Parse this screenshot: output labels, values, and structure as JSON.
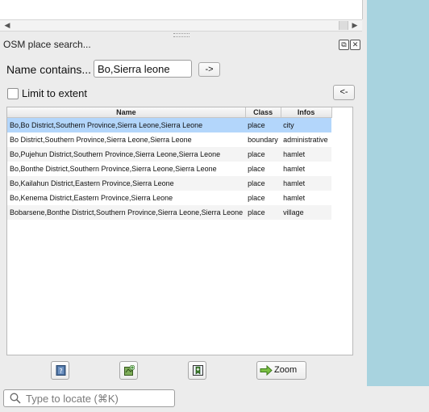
{
  "panel": {
    "title": "OSM place search...",
    "name_label": "Name contains...",
    "name_value": "Bo,Sierra leone",
    "go_label": "->",
    "limit_label": "Limit to extent",
    "back_label": "<-"
  },
  "results": {
    "columns": [
      "Name",
      "Class",
      "Infos"
    ],
    "selected_index": 0,
    "rows": [
      {
        "name": "Bo,Bo District,Southern Province,Sierra Leone,Sierra Leone",
        "class": "place",
        "infos": "city"
      },
      {
        "name": "Bo District,Southern Province,Sierra Leone,Sierra Leone",
        "class": "boundary",
        "infos": "administrative"
      },
      {
        "name": "Bo,Pujehun District,Southern Province,Sierra Leone,Sierra Leone",
        "class": "place",
        "infos": "hamlet"
      },
      {
        "name": "Bo,Bonthe District,Southern Province,Sierra Leone,Sierra Leone",
        "class": "place",
        "infos": "hamlet"
      },
      {
        "name": "Bo,Kailahun District,Eastern Province,Sierra Leone",
        "class": "place",
        "infos": "hamlet"
      },
      {
        "name": "Bo,Kenema District,Eastern Province,Sierra Leone",
        "class": "place",
        "infos": "hamlet"
      },
      {
        "name": "Bobarsene,Bonthe District,Southern Province,Sierra Leone,Sierra Leone",
        "class": "place",
        "infos": "village"
      }
    ]
  },
  "toolbar": {
    "zoom_label": "Zoom",
    "icons": [
      "help-book-icon",
      "add-layer-icon",
      "add-bookmark-icon",
      "zoom-arrow-icon"
    ]
  },
  "locator": {
    "placeholder": "Type to locate (⌘K)"
  },
  "colors": {
    "selection": "#b3d6fb",
    "map_water": "#a8d3df"
  }
}
